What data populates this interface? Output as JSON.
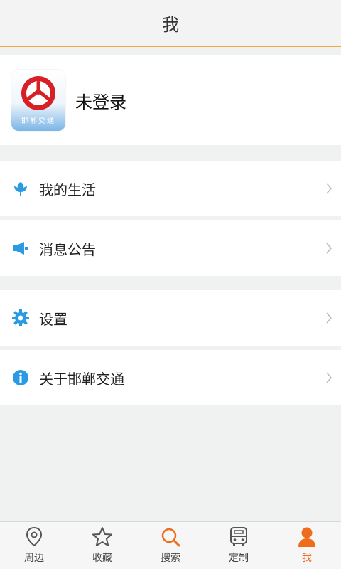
{
  "header": {
    "title": "我"
  },
  "profile": {
    "name": "未登录",
    "logo_text": "邯郸交通"
  },
  "menu": {
    "group1": [
      {
        "label": "我的生活",
        "icon": "flower-icon"
      },
      {
        "label": "消息公告",
        "icon": "megaphone-icon"
      }
    ],
    "group2": [
      {
        "label": "设置",
        "icon": "gear-icon"
      },
      {
        "label": "关于邯郸交通",
        "icon": "info-icon"
      }
    ]
  },
  "tabbar": {
    "items": [
      {
        "label": "周边",
        "icon": "location-pin-icon"
      },
      {
        "label": "收藏",
        "icon": "star-icon"
      },
      {
        "label": "搜索",
        "icon": "search-icon"
      },
      {
        "label": "定制",
        "icon": "bus-icon"
      },
      {
        "label": "我",
        "icon": "person-icon",
        "active": true
      }
    ]
  },
  "colors": {
    "accent": "#ee6c1a",
    "icon_blue": "#2a9be3",
    "header_line": "#f2a93b",
    "background": "#eff2f1"
  }
}
